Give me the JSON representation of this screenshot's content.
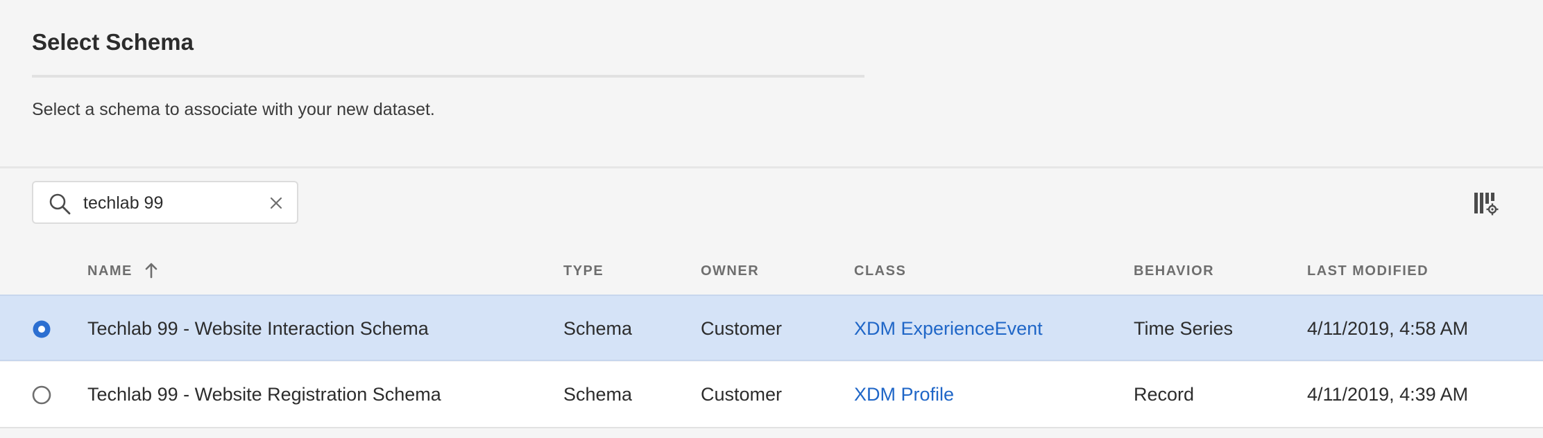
{
  "header": {
    "title": "Select Schema",
    "description": "Select a schema to associate with your new dataset."
  },
  "search": {
    "value": "techlab 99",
    "placeholder": ""
  },
  "table": {
    "columns": {
      "name": "NAME",
      "type": "TYPE",
      "owner": "OWNER",
      "class": "CLASS",
      "behavior": "BEHAVIOR",
      "last_modified": "LAST MODIFIED"
    },
    "sort": {
      "column": "name",
      "direction": "ascending"
    },
    "rows": [
      {
        "selected": true,
        "name": "Techlab 99 - Website Interaction Schema",
        "type": "Schema",
        "owner": "Customer",
        "class": "XDM ExperienceEvent",
        "behavior": "Time Series",
        "last_modified": "4/11/2019, 4:58 AM"
      },
      {
        "selected": false,
        "name": "Techlab 99 - Website Registration Schema",
        "type": "Schema",
        "owner": "Customer",
        "class": "XDM Profile",
        "behavior": "Record",
        "last_modified": "4/11/2019, 4:39 AM"
      }
    ]
  },
  "colors": {
    "accent": "#2c6fd1",
    "link": "#1f66c7",
    "selected_row": "#d5e3f7"
  },
  "icons": {
    "search": "search-icon",
    "clear": "close-icon",
    "sort": "arrow-up-icon",
    "column_settings": "column-settings-icon",
    "radio_on": "radio-selected-icon",
    "radio_off": "radio-unselected-icon"
  }
}
